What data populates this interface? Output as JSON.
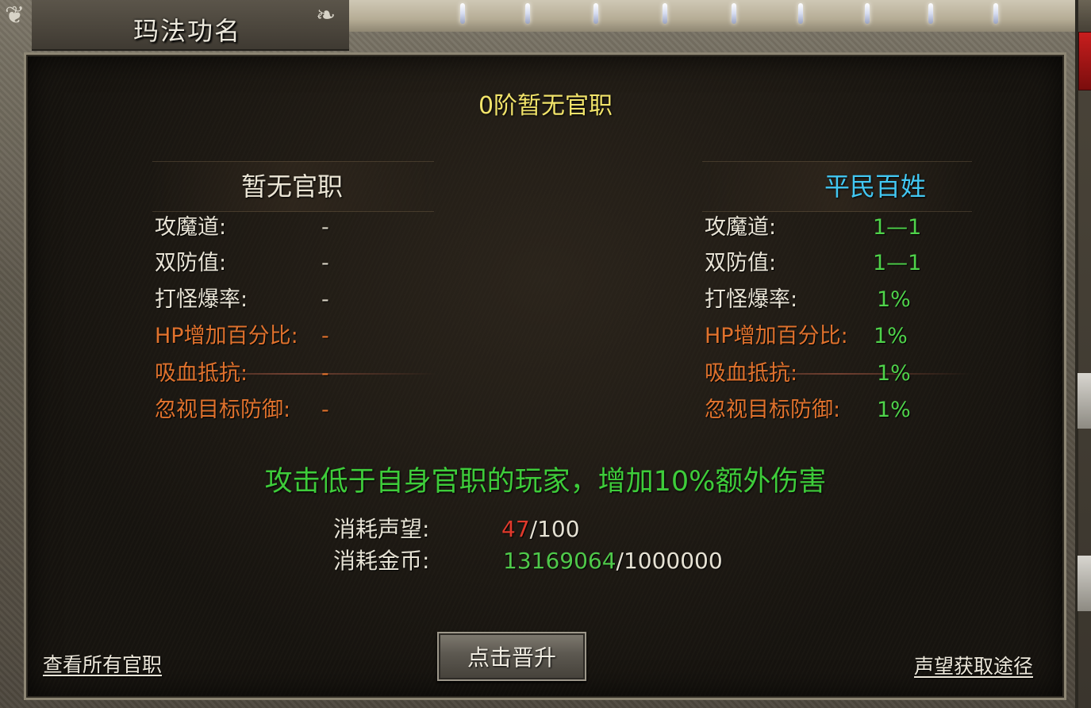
{
  "window": {
    "title": "玛法功名"
  },
  "rank_title": "0阶暂无官职",
  "columns": {
    "current": {
      "header": "暂无官职",
      "stats": [
        {
          "label": "攻魔道:",
          "value": "-",
          "tone": "white"
        },
        {
          "label": "双防值:",
          "value": "-",
          "tone": "white"
        },
        {
          "label": "打怪爆率:",
          "value": "-",
          "tone": "white"
        },
        {
          "label": "HP增加百分比:",
          "value": "-",
          "tone": "orange"
        },
        {
          "label": "吸血抵抗:",
          "value": "-",
          "tone": "orange"
        },
        {
          "label": "忽视目标防御:",
          "value": "-",
          "tone": "orange"
        }
      ]
    },
    "next": {
      "header": "平民百姓",
      "stats": [
        {
          "label": "攻魔道:",
          "value": "1—1",
          "tone": "white"
        },
        {
          "label": "双防值:",
          "value": "1—1",
          "tone": "white"
        },
        {
          "label": "打怪爆率:",
          "value": "1%",
          "tone": "white"
        },
        {
          "label": "HP增加百分比:",
          "value": "1%",
          "tone": "orange"
        },
        {
          "label": "吸血抵抗:",
          "value": "1%",
          "tone": "orange"
        },
        {
          "label": "忽视目标防御:",
          "value": "1%",
          "tone": "orange"
        }
      ]
    }
  },
  "bonus_text": "攻击低于自身官职的玩家，增加10%额外伤害",
  "costs": {
    "prestige": {
      "label": "消耗声望:",
      "current": "47",
      "required": "/100"
    },
    "gold": {
      "label": "消耗金币:",
      "current": "13169064",
      "required": "/1000000"
    }
  },
  "actions": {
    "view_all_label": "查看所有官职",
    "promote_label": "点击晋升",
    "prestige_source_label": "声望获取途径"
  },
  "colors": {
    "rank_title": "#f1e36a",
    "next_header": "#42c7f2",
    "stat_value_green": "#4fd24a",
    "stat_label_orange": "#e0722d",
    "bonus_text": "#3ecc3a",
    "cost_insufficient": "#e03a2c",
    "cost_sufficient": "#4fc84a"
  }
}
